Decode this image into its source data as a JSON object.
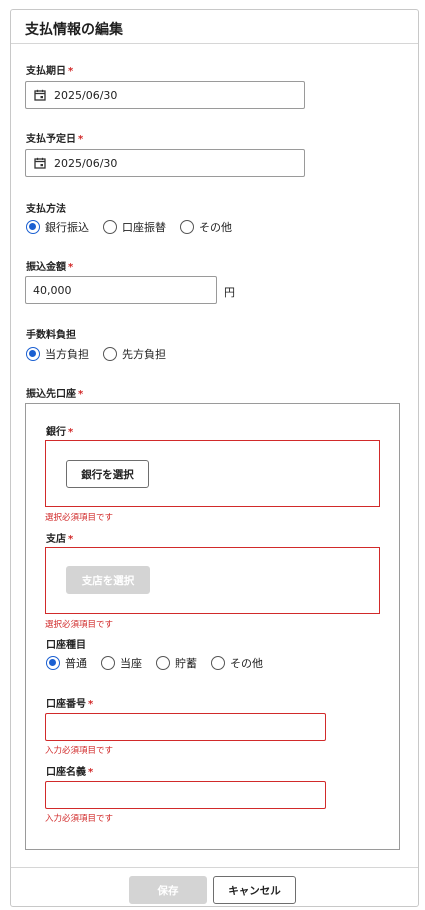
{
  "page_title": "支払情報の編集",
  "required_mark": "*",
  "payment_due": {
    "label": "支払期日",
    "value": "2025/06/30",
    "icon": "calendar-icon"
  },
  "payment_planned": {
    "label": "支払予定日",
    "value": "2025/06/30",
    "icon": "calendar-icon"
  },
  "payment_method": {
    "label": "支払方法",
    "options": [
      "銀行振込",
      "口座振替",
      "その他"
    ],
    "selected": "銀行振込"
  },
  "amount": {
    "label": "振込金額",
    "value": "40,000",
    "unit": "円"
  },
  "fee_bearer": {
    "label": "手数料負担",
    "options": [
      "当方負担",
      "先方負担"
    ],
    "selected": "当方負担"
  },
  "destination": {
    "label": "振込先口座",
    "bank": {
      "label": "銀行",
      "button": "銀行を選択",
      "error": "選択必須項目です"
    },
    "branch": {
      "label": "支店",
      "button": "支店を選択",
      "error": "選択必須項目です"
    },
    "account_type": {
      "label": "口座種目",
      "options": [
        "普通",
        "当座",
        "貯蓄",
        "その他"
      ],
      "selected": "普通"
    },
    "account_number": {
      "label": "口座番号",
      "value": "",
      "error": "入力必須項目です"
    },
    "account_name": {
      "label": "口座名義",
      "value": "",
      "error": "入力必須項目です"
    }
  },
  "footer": {
    "save_label": "保存",
    "cancel_label": "キャンセル"
  },
  "colors": {
    "accent": "#1a5fd1",
    "error": "#d12a2a",
    "disabled": "#d4d4d4"
  }
}
